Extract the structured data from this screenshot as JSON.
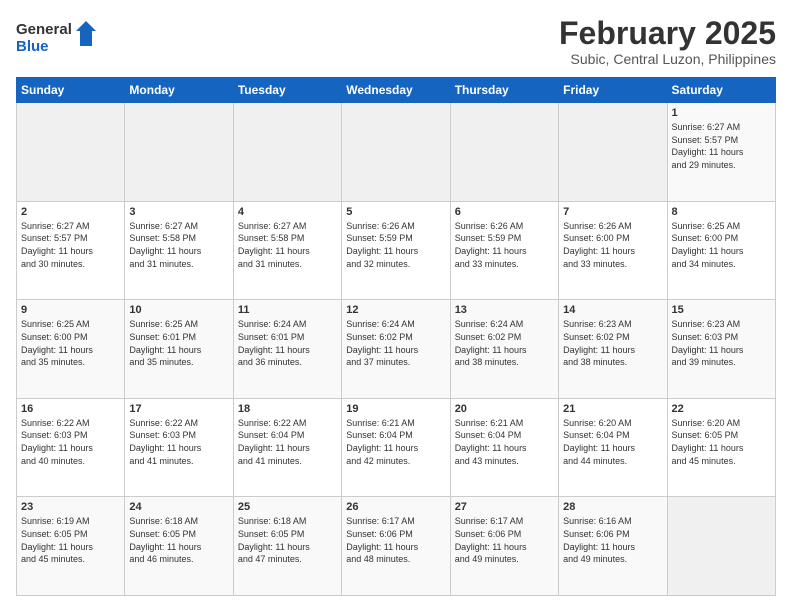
{
  "header": {
    "logo_line1": "General",
    "logo_line2": "Blue",
    "title": "February 2025",
    "subtitle": "Subic, Central Luzon, Philippines"
  },
  "weekdays": [
    "Sunday",
    "Monday",
    "Tuesday",
    "Wednesday",
    "Thursday",
    "Friday",
    "Saturday"
  ],
  "weeks": [
    [
      {
        "day": "",
        "info": ""
      },
      {
        "day": "",
        "info": ""
      },
      {
        "day": "",
        "info": ""
      },
      {
        "day": "",
        "info": ""
      },
      {
        "day": "",
        "info": ""
      },
      {
        "day": "",
        "info": ""
      },
      {
        "day": "1",
        "info": "Sunrise: 6:27 AM\nSunset: 5:57 PM\nDaylight: 11 hours\nand 29 minutes."
      }
    ],
    [
      {
        "day": "2",
        "info": "Sunrise: 6:27 AM\nSunset: 5:57 PM\nDaylight: 11 hours\nand 30 minutes."
      },
      {
        "day": "3",
        "info": "Sunrise: 6:27 AM\nSunset: 5:58 PM\nDaylight: 11 hours\nand 31 minutes."
      },
      {
        "day": "4",
        "info": "Sunrise: 6:27 AM\nSunset: 5:58 PM\nDaylight: 11 hours\nand 31 minutes."
      },
      {
        "day": "5",
        "info": "Sunrise: 6:26 AM\nSunset: 5:59 PM\nDaylight: 11 hours\nand 32 minutes."
      },
      {
        "day": "6",
        "info": "Sunrise: 6:26 AM\nSunset: 5:59 PM\nDaylight: 11 hours\nand 33 minutes."
      },
      {
        "day": "7",
        "info": "Sunrise: 6:26 AM\nSunset: 6:00 PM\nDaylight: 11 hours\nand 33 minutes."
      },
      {
        "day": "8",
        "info": "Sunrise: 6:25 AM\nSunset: 6:00 PM\nDaylight: 11 hours\nand 34 minutes."
      }
    ],
    [
      {
        "day": "9",
        "info": "Sunrise: 6:25 AM\nSunset: 6:00 PM\nDaylight: 11 hours\nand 35 minutes."
      },
      {
        "day": "10",
        "info": "Sunrise: 6:25 AM\nSunset: 6:01 PM\nDaylight: 11 hours\nand 35 minutes."
      },
      {
        "day": "11",
        "info": "Sunrise: 6:24 AM\nSunset: 6:01 PM\nDaylight: 11 hours\nand 36 minutes."
      },
      {
        "day": "12",
        "info": "Sunrise: 6:24 AM\nSunset: 6:02 PM\nDaylight: 11 hours\nand 37 minutes."
      },
      {
        "day": "13",
        "info": "Sunrise: 6:24 AM\nSunset: 6:02 PM\nDaylight: 11 hours\nand 38 minutes."
      },
      {
        "day": "14",
        "info": "Sunrise: 6:23 AM\nSunset: 6:02 PM\nDaylight: 11 hours\nand 38 minutes."
      },
      {
        "day": "15",
        "info": "Sunrise: 6:23 AM\nSunset: 6:03 PM\nDaylight: 11 hours\nand 39 minutes."
      }
    ],
    [
      {
        "day": "16",
        "info": "Sunrise: 6:22 AM\nSunset: 6:03 PM\nDaylight: 11 hours\nand 40 minutes."
      },
      {
        "day": "17",
        "info": "Sunrise: 6:22 AM\nSunset: 6:03 PM\nDaylight: 11 hours\nand 41 minutes."
      },
      {
        "day": "18",
        "info": "Sunrise: 6:22 AM\nSunset: 6:04 PM\nDaylight: 11 hours\nand 41 minutes."
      },
      {
        "day": "19",
        "info": "Sunrise: 6:21 AM\nSunset: 6:04 PM\nDaylight: 11 hours\nand 42 minutes."
      },
      {
        "day": "20",
        "info": "Sunrise: 6:21 AM\nSunset: 6:04 PM\nDaylight: 11 hours\nand 43 minutes."
      },
      {
        "day": "21",
        "info": "Sunrise: 6:20 AM\nSunset: 6:04 PM\nDaylight: 11 hours\nand 44 minutes."
      },
      {
        "day": "22",
        "info": "Sunrise: 6:20 AM\nSunset: 6:05 PM\nDaylight: 11 hours\nand 45 minutes."
      }
    ],
    [
      {
        "day": "23",
        "info": "Sunrise: 6:19 AM\nSunset: 6:05 PM\nDaylight: 11 hours\nand 45 minutes."
      },
      {
        "day": "24",
        "info": "Sunrise: 6:18 AM\nSunset: 6:05 PM\nDaylight: 11 hours\nand 46 minutes."
      },
      {
        "day": "25",
        "info": "Sunrise: 6:18 AM\nSunset: 6:05 PM\nDaylight: 11 hours\nand 47 minutes."
      },
      {
        "day": "26",
        "info": "Sunrise: 6:17 AM\nSunset: 6:06 PM\nDaylight: 11 hours\nand 48 minutes."
      },
      {
        "day": "27",
        "info": "Sunrise: 6:17 AM\nSunset: 6:06 PM\nDaylight: 11 hours\nand 49 minutes."
      },
      {
        "day": "28",
        "info": "Sunrise: 6:16 AM\nSunset: 6:06 PM\nDaylight: 11 hours\nand 49 minutes."
      },
      {
        "day": "",
        "info": ""
      }
    ]
  ]
}
